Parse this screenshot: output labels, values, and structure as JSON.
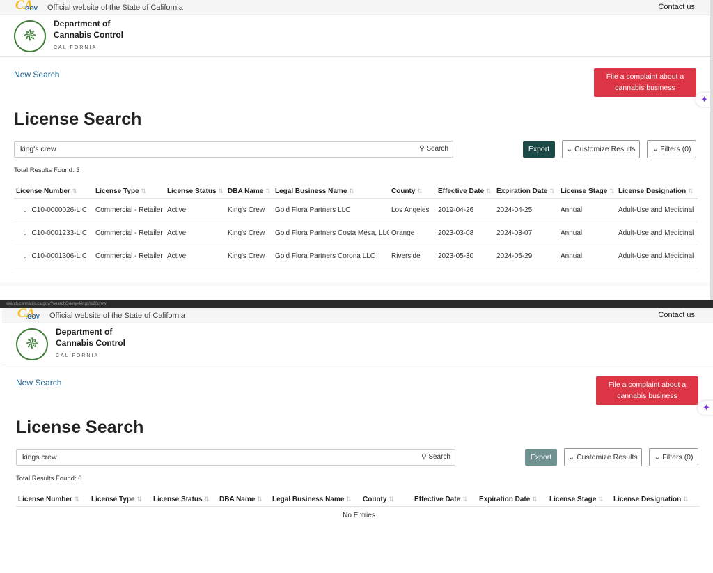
{
  "site": {
    "official": "Official website of the State of California",
    "contact": "Contact us",
    "ca_logo": "CA",
    "ca_gov": ".GOV",
    "dept_name_1": "Department of",
    "dept_name_2": "Cannabis Control",
    "dept_state": "CALIFORNIA",
    "seal_icon": "cannabis-leaf-icon"
  },
  "colors": {
    "complaint": "#dc3545",
    "export": "#1b4a47",
    "link": "#1d5f8a",
    "seal": "#3f7f3a"
  },
  "nav": {
    "new_search": "New Search",
    "complaint": "File a complaint about a cannabis business",
    "page_title": "License Search",
    "search_btn": "Search",
    "export": "Export",
    "customize": "Customize Results",
    "filters": "Filters (0)"
  },
  "columns": [
    "License Number",
    "License Type",
    "License Status",
    "DBA Name",
    "Legal Business Name",
    "County",
    "Effective Date",
    "Expiration Date",
    "License Stage",
    "License Designation"
  ],
  "browser_url": "search.cannabis.ca.gov/?searchQuery=kings%20crew",
  "screen1": {
    "query": "king's crew",
    "total": "Total Results Found: 3",
    "rows": [
      [
        "C10-0000026-LIC",
        "Commercial - Retailer",
        "Active",
        "King's Crew",
        "Gold Flora Partners LLC",
        "Los Angeles",
        "2019-04-26",
        "2024-04-25",
        "Annual",
        "Adult-Use and Medicinal"
      ],
      [
        "C10-0001233-LIC",
        "Commercial - Retailer",
        "Active",
        "King's Crew",
        "Gold Flora Partners Costa Mesa, LLC",
        "Orange",
        "2023-03-08",
        "2024-03-07",
        "Annual",
        "Adult-Use and Medicinal"
      ],
      [
        "C10-0001306-LIC",
        "Commercial - Retailer",
        "Active",
        "King's Crew",
        "Gold Flora Partners Corona LLC",
        "Riverside",
        "2023-05-30",
        "2024-05-29",
        "Annual",
        "Adult-Use and Medicinal"
      ]
    ]
  },
  "screen2": {
    "query": "kings crew",
    "total": "Total Results Found: 0",
    "empty": "No Entries"
  }
}
